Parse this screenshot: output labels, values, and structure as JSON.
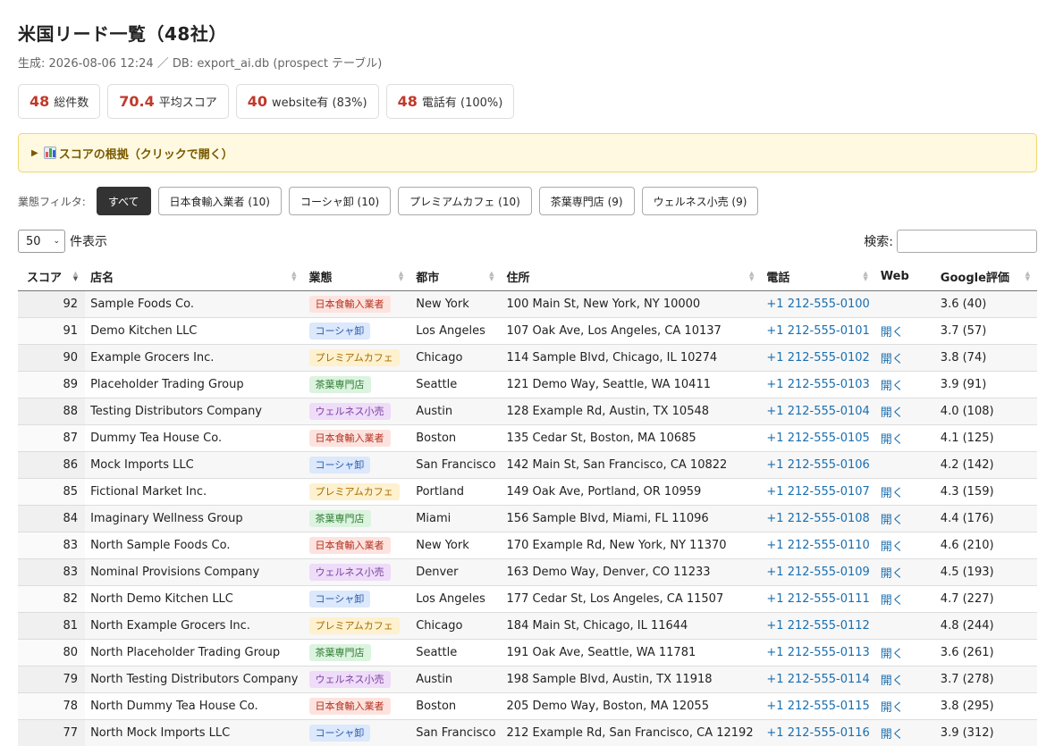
{
  "page": {
    "title": "米国リード一覧（48社）",
    "subtitle": "生成: 2026-08-06 12:24 ／ DB: export_ai.db (prospect テーブル)"
  },
  "stats": [
    {
      "num": "48",
      "label": "総件数"
    },
    {
      "num": "70.4",
      "label": "平均スコア"
    },
    {
      "num": "40",
      "label": "website有 (83%)"
    },
    {
      "num": "48",
      "label": "電話有 (100%)"
    }
  ],
  "criteria": {
    "label": "スコアの根拠（クリックで開く）",
    "icon": "bar-chart-icon"
  },
  "filters": {
    "label": "業態フィルタ:",
    "buttons": [
      "すべて",
      "日本食輸入業者 (10)",
      "コーシャ卸 (10)",
      "プレミアムカフェ (10)",
      "茶葉専門店 (9)",
      "ウェルネス小売 (9)"
    ]
  },
  "length": {
    "value": "50",
    "suffix": "件表示"
  },
  "search": {
    "label": "検索:"
  },
  "table": {
    "headers": [
      "スコア",
      "店名",
      "業態",
      "都市",
      "住所",
      "電話",
      "Web",
      "Google評価"
    ],
    "rows": [
      {
        "score": "92",
        "name": "Sample Foods Co.",
        "type": "日本食輸入業者",
        "cls": "b-jp",
        "city": "New York",
        "address": "100 Main St, New York, NY 10000",
        "phone": "+1 212-555-0100",
        "web": "",
        "rating": "3.6 (40)"
      },
      {
        "score": "91",
        "name": "Demo Kitchen LLC",
        "type": "コーシャ卸",
        "cls": "b-ko",
        "city": "Los Angeles",
        "address": "107 Oak Ave, Los Angeles, CA 10137",
        "phone": "+1 212-555-0101",
        "web": "開く",
        "rating": "3.7 (57)"
      },
      {
        "score": "90",
        "name": "Example Grocers Inc.",
        "type": "プレミアムカフェ",
        "cls": "b-ca",
        "city": "Chicago",
        "address": "114 Sample Blvd, Chicago, IL 10274",
        "phone": "+1 212-555-0102",
        "web": "開く",
        "rating": "3.8 (74)"
      },
      {
        "score": "89",
        "name": "Placeholder Trading Group",
        "type": "茶葉専門店",
        "cls": "b-te",
        "city": "Seattle",
        "address": "121 Demo Way, Seattle, WA 10411",
        "phone": "+1 212-555-0103",
        "web": "開く",
        "rating": "3.9 (91)"
      },
      {
        "score": "88",
        "name": "Testing Distributors Company",
        "type": "ウェルネス小売",
        "cls": "b-we",
        "city": "Austin",
        "address": "128 Example Rd, Austin, TX 10548",
        "phone": "+1 212-555-0104",
        "web": "開く",
        "rating": "4.0 (108)"
      },
      {
        "score": "87",
        "name": "Dummy Tea House Co.",
        "type": "日本食輸入業者",
        "cls": "b-jp",
        "city": "Boston",
        "address": "135 Cedar St, Boston, MA 10685",
        "phone": "+1 212-555-0105",
        "web": "開く",
        "rating": "4.1 (125)"
      },
      {
        "score": "86",
        "name": "Mock Imports LLC",
        "type": "コーシャ卸",
        "cls": "b-ko",
        "city": "San Francisco",
        "address": "142 Main St, San Francisco, CA 10822",
        "phone": "+1 212-555-0106",
        "web": "",
        "rating": "4.2 (142)"
      },
      {
        "score": "85",
        "name": "Fictional Market Inc.",
        "type": "プレミアムカフェ",
        "cls": "b-ca",
        "city": "Portland",
        "address": "149 Oak Ave, Portland, OR 10959",
        "phone": "+1 212-555-0107",
        "web": "開く",
        "rating": "4.3 (159)"
      },
      {
        "score": "84",
        "name": "Imaginary Wellness Group",
        "type": "茶葉専門店",
        "cls": "b-te",
        "city": "Miami",
        "address": "156 Sample Blvd, Miami, FL 11096",
        "phone": "+1 212-555-0108",
        "web": "開く",
        "rating": "4.4 (176)"
      },
      {
        "score": "83",
        "name": "North Sample Foods Co.",
        "type": "日本食輸入業者",
        "cls": "b-jp",
        "city": "New York",
        "address": "170 Example Rd, New York, NY 11370",
        "phone": "+1 212-555-0110",
        "web": "開く",
        "rating": "4.6 (210)"
      },
      {
        "score": "83",
        "name": "Nominal Provisions Company",
        "type": "ウェルネス小売",
        "cls": "b-we",
        "city": "Denver",
        "address": "163 Demo Way, Denver, CO 11233",
        "phone": "+1 212-555-0109",
        "web": "開く",
        "rating": "4.5 (193)"
      },
      {
        "score": "82",
        "name": "North Demo Kitchen LLC",
        "type": "コーシャ卸",
        "cls": "b-ko",
        "city": "Los Angeles",
        "address": "177 Cedar St, Los Angeles, CA 11507",
        "phone": "+1 212-555-0111",
        "web": "開く",
        "rating": "4.7 (227)"
      },
      {
        "score": "81",
        "name": "North Example Grocers Inc.",
        "type": "プレミアムカフェ",
        "cls": "b-ca",
        "city": "Chicago",
        "address": "184 Main St, Chicago, IL 11644",
        "phone": "+1 212-555-0112",
        "web": "",
        "rating": "4.8 (244)"
      },
      {
        "score": "80",
        "name": "North Placeholder Trading Group",
        "type": "茶葉専門店",
        "cls": "b-te",
        "city": "Seattle",
        "address": "191 Oak Ave, Seattle, WA 11781",
        "phone": "+1 212-555-0113",
        "web": "開く",
        "rating": "3.6 (261)"
      },
      {
        "score": "79",
        "name": "North Testing Distributors Company",
        "type": "ウェルネス小売",
        "cls": "b-we",
        "city": "Austin",
        "address": "198 Sample Blvd, Austin, TX 11918",
        "phone": "+1 212-555-0114",
        "web": "開く",
        "rating": "3.7 (278)"
      },
      {
        "score": "78",
        "name": "North Dummy Tea House Co.",
        "type": "日本食輸入業者",
        "cls": "b-jp",
        "city": "Boston",
        "address": "205 Demo Way, Boston, MA 12055",
        "phone": "+1 212-555-0115",
        "web": "開く",
        "rating": "3.8 (295)"
      },
      {
        "score": "77",
        "name": "North Mock Imports LLC",
        "type": "コーシャ卸",
        "cls": "b-ko",
        "city": "San Francisco",
        "address": "212 Example Rd, San Francisco, CA 12192",
        "phone": "+1 212-555-0116",
        "web": "開く",
        "rating": "3.9 (312)"
      }
    ]
  }
}
